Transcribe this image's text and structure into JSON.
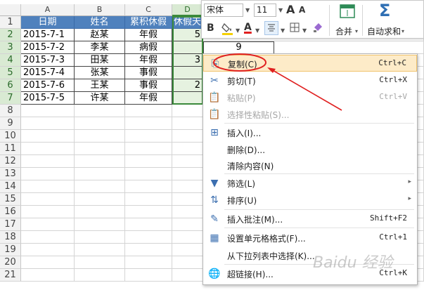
{
  "columns": [
    "A",
    "B",
    "C",
    "D"
  ],
  "rows": [
    "1",
    "2",
    "3",
    "4",
    "5",
    "6",
    "7",
    "8",
    "9",
    "10",
    "11",
    "12",
    "13",
    "14",
    "15",
    "16",
    "17",
    "18",
    "19",
    "20",
    "21"
  ],
  "table": {
    "headers": [
      "日期",
      "姓名",
      "累积休假",
      "休假天"
    ],
    "rows": [
      [
        "2015-7-1",
        "赵某",
        "年假",
        "5"
      ],
      [
        "2015-7-2",
        "李某",
        "病假",
        ""
      ],
      [
        "2015-7-3",
        "田某",
        "年假",
        "3"
      ],
      [
        "2015-7-4",
        "张某",
        "事假",
        ""
      ],
      [
        "2015-7-6",
        "王某",
        "事假",
        "2"
      ],
      [
        "2015-7-5",
        "许某",
        "年假",
        ""
      ]
    ]
  },
  "extra_cell_value": "9",
  "toolbar": {
    "font_name": "宋体",
    "font_size": "11",
    "grow_font": "A",
    "shrink_font": "A",
    "bold": "B",
    "font_color_glyph": "A",
    "merge_label": "合并",
    "autosum_label": "自动求和",
    "autosum_glyph": "Σ",
    "merge_arrow": "▾",
    "autosum_arrow": "▾"
  },
  "menu": {
    "items": [
      {
        "label": "复制(C)",
        "shortcut": "Ctrl+C",
        "icon": "copy-icon",
        "glyph": "⎘",
        "highlighted": true,
        "disabled": false
      },
      {
        "label": "剪切(T)",
        "shortcut": "Ctrl+X",
        "icon": "scissors-icon",
        "glyph": "✂",
        "highlighted": false,
        "disabled": false
      },
      {
        "label": "粘贴(P)",
        "shortcut": "Ctrl+V",
        "icon": "paste-icon",
        "glyph": "📋",
        "highlighted": false,
        "disabled": true
      },
      {
        "label": "选择性粘贴(S)...",
        "shortcut": "",
        "icon": "paste-special-icon",
        "glyph": "📋",
        "highlighted": false,
        "disabled": true
      },
      {
        "label": "插入(I)...",
        "shortcut": "",
        "icon": "insert-icon",
        "glyph": "⊞",
        "highlighted": false,
        "disabled": false
      },
      {
        "label": "删除(D)...",
        "shortcut": "",
        "icon": "",
        "glyph": "",
        "highlighted": false,
        "disabled": false
      },
      {
        "label": "清除内容(N)",
        "shortcut": "",
        "icon": "",
        "glyph": "",
        "highlighted": false,
        "disabled": false
      },
      {
        "label": "筛选(L)",
        "shortcut": "",
        "icon": "filter-icon",
        "glyph": "▼",
        "highlighted": false,
        "disabled": false,
        "submenu": true
      },
      {
        "label": "排序(U)",
        "shortcut": "",
        "icon": "sort-icon",
        "glyph": "⇅",
        "highlighted": false,
        "disabled": false,
        "submenu": true
      },
      {
        "label": "插入批注(M)...",
        "shortcut": "Shift+F2",
        "icon": "comment-icon",
        "glyph": "✎",
        "highlighted": false,
        "disabled": false
      },
      {
        "label": "设置单元格格式(F)...",
        "shortcut": "Ctrl+1",
        "icon": "format-cells-icon",
        "glyph": "▦",
        "highlighted": false,
        "disabled": false
      },
      {
        "label": "从下拉列表中选择(K)...",
        "shortcut": "",
        "icon": "",
        "glyph": "",
        "highlighted": false,
        "disabled": false
      },
      {
        "label": "超链接(H)...",
        "shortcut": "Ctrl+K",
        "icon": "hyperlink-icon",
        "glyph": "🌐",
        "highlighted": false,
        "disabled": false
      }
    ],
    "submenu_arrow": "▸"
  },
  "watermark_text": "Baidu 经验",
  "colors": {
    "table_header": "#4f81bd",
    "selection_green": "#3b8a3b",
    "highlight": "#fdebc8",
    "annotation_red": "#e02020"
  }
}
